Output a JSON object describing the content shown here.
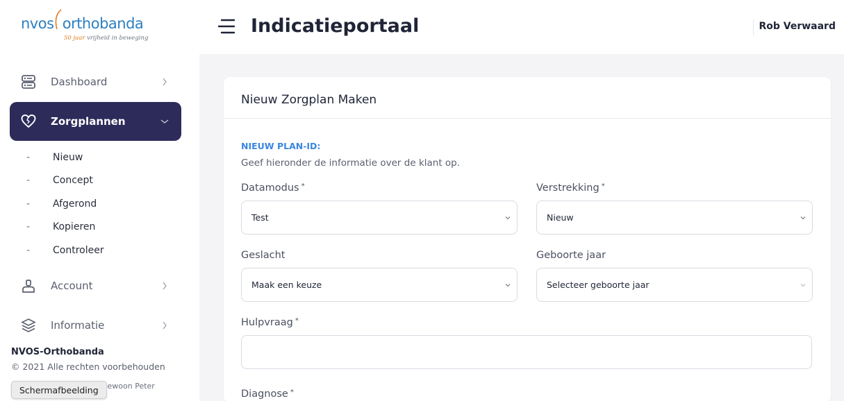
{
  "brand": {
    "logo_left": "nvos",
    "logo_right": "orthobanda",
    "tagline_accent": "50 jaar",
    "tagline_rest": "vrijheid in beweging"
  },
  "header": {
    "title": "Indicatieportaal",
    "user": "Rob Verwaard"
  },
  "sidebar": {
    "items": [
      {
        "label": "Dashboard",
        "icon": "dashboard-icon"
      },
      {
        "label": "Zorgplannen",
        "icon": "heart-icon",
        "active": true
      },
      {
        "label": "Account",
        "icon": "user-icon"
      },
      {
        "label": "Informatie",
        "icon": "layers-icon"
      }
    ],
    "submenu": [
      "Nieuw",
      "Concept",
      "Afgerond",
      "Kopieren",
      "Controleer"
    ],
    "dash": "-",
    "footer_brand": "NVOS-Orthobanda",
    "footer_copy": "© 2021 Alle rechten voorbehouden",
    "footer_by": "Gewoon Peter",
    "tooltip": "Schermafbeelding"
  },
  "card": {
    "title": "Nieuw Zorgplan Maken",
    "plan_label": "NIEUW PLAN-ID:",
    "plan_help": "Geef hieronder de informatie over de klant op."
  },
  "form": {
    "required_mark": "*",
    "datamodus": {
      "label": "Datamodus",
      "value": "Test"
    },
    "verstrekking": {
      "label": "Verstrekking",
      "value": "Nieuw"
    },
    "geslacht": {
      "label": "Geslacht",
      "value": "Maak een keuze"
    },
    "geboortejaar": {
      "label": "Geboorte jaar",
      "value": "Selecteer geboorte jaar"
    },
    "hulpvraag": {
      "label": "Hulpvraag",
      "value": ""
    },
    "diagnose": {
      "label": "Diagnose"
    }
  },
  "colors": {
    "accent_dark": "#2d2b5a",
    "link_blue": "#3a86e0",
    "brand_blue": "#2d7fc1",
    "brand_orange": "#e07b1f"
  }
}
